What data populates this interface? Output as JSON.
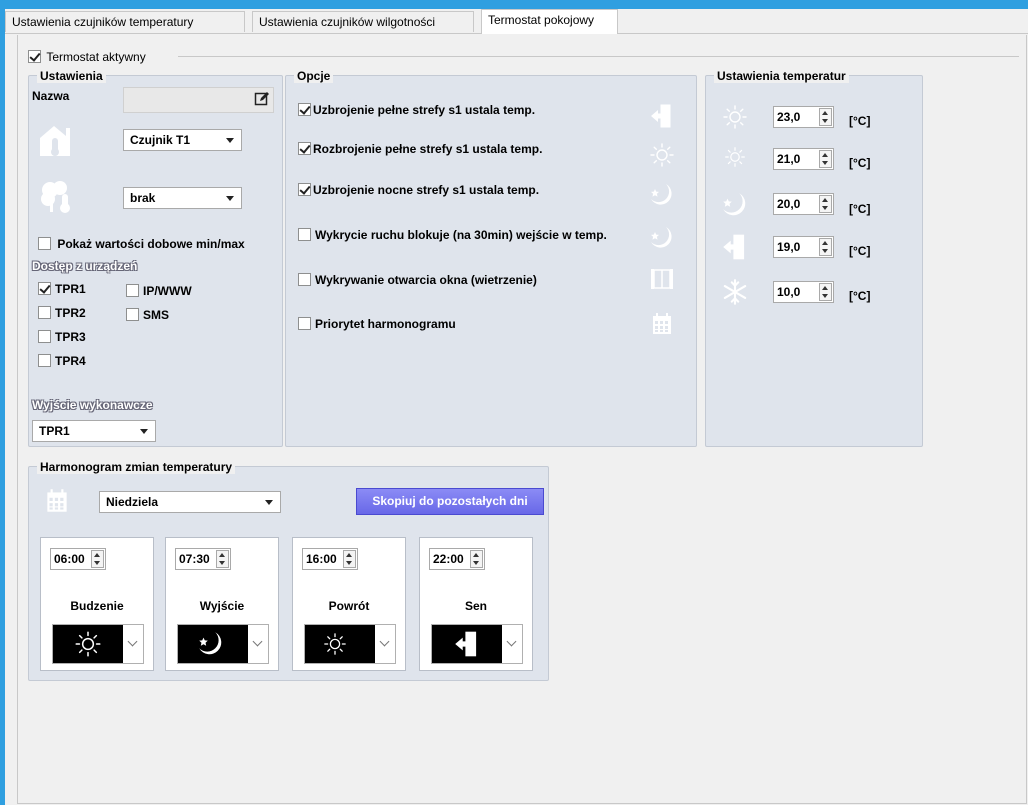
{
  "tabs": [
    {
      "label": "Ustawienia czujników temperatury"
    },
    {
      "label": "Ustawienia czujników wilgotności"
    },
    {
      "label": "Termostat pokojowy"
    }
  ],
  "active_tab": "Termostat pokojowy",
  "thermostat_active": {
    "label": "Termostat aktywny",
    "checked": true
  },
  "settings": {
    "title": "Ustawienia",
    "name_label": "Nazwa",
    "name_value": "",
    "sensor1": "Czujnik T1",
    "sensor2": "brak",
    "show_minmax": {
      "label": "Pokaż wartości dobowe min/max",
      "checked": false
    },
    "access_title": "Dostęp z urządzeń",
    "access": [
      {
        "label": "TPR1",
        "checked": true
      },
      {
        "label": "TPR2",
        "checked": false
      },
      {
        "label": "TPR3",
        "checked": false
      },
      {
        "label": "TPR4",
        "checked": false
      },
      {
        "label": "IP/WWW",
        "checked": false
      },
      {
        "label": "SMS",
        "checked": false
      }
    ],
    "output_title": "Wyjście wykonawcze",
    "output_value": "TPR1"
  },
  "options": {
    "title": "Opcje",
    "items": [
      {
        "label": "Uzbrojenie pełne strefy s1 ustala temp.",
        "checked": true,
        "icon": "door-exit-icon"
      },
      {
        "label": "Rozbrojenie pełne strefy s1 ustala temp.",
        "checked": true,
        "icon": "sun-icon"
      },
      {
        "label": "Uzbrojenie nocne strefy s1 ustala temp.",
        "checked": true,
        "icon": "moon-star-icon"
      },
      {
        "label": "Wykrycie ruchu blokuje (na 30min) wejście w temp.",
        "checked": false,
        "icon": "moon-star-icon"
      },
      {
        "label": "Wykrywanie otwarcia okna (wietrzenie)",
        "checked": false,
        "icon": "window-icon"
      },
      {
        "label": "Priorytet harmonogramu",
        "checked": false,
        "icon": "calendar-icon"
      }
    ]
  },
  "temps": {
    "title": "Ustawienia temperatur",
    "unit": "[°C]",
    "rows": [
      {
        "icon": "sun-large-icon",
        "value": "23,0"
      },
      {
        "icon": "sun-small-icon",
        "value": "21,0"
      },
      {
        "icon": "moon-star-icon",
        "value": "20,0"
      },
      {
        "icon": "door-exit-icon",
        "value": "19,0"
      },
      {
        "icon": "snowflake-icon",
        "value": "10,0"
      }
    ]
  },
  "schedule": {
    "title": "Harmonogram zmian temperatury",
    "day": "Niedziela",
    "copy_button": "Skopiuj do pozostałych dni",
    "slots": [
      {
        "time": "06:00",
        "label": "Budzenie",
        "icon": "sun-large-icon"
      },
      {
        "time": "07:30",
        "label": "Wyjście",
        "icon": "moon-star-icon"
      },
      {
        "time": "16:00",
        "label": "Powrót",
        "icon": "sun-small-icon"
      },
      {
        "time": "22:00",
        "label": "Sen",
        "icon": "door-exit-icon"
      }
    ]
  }
}
